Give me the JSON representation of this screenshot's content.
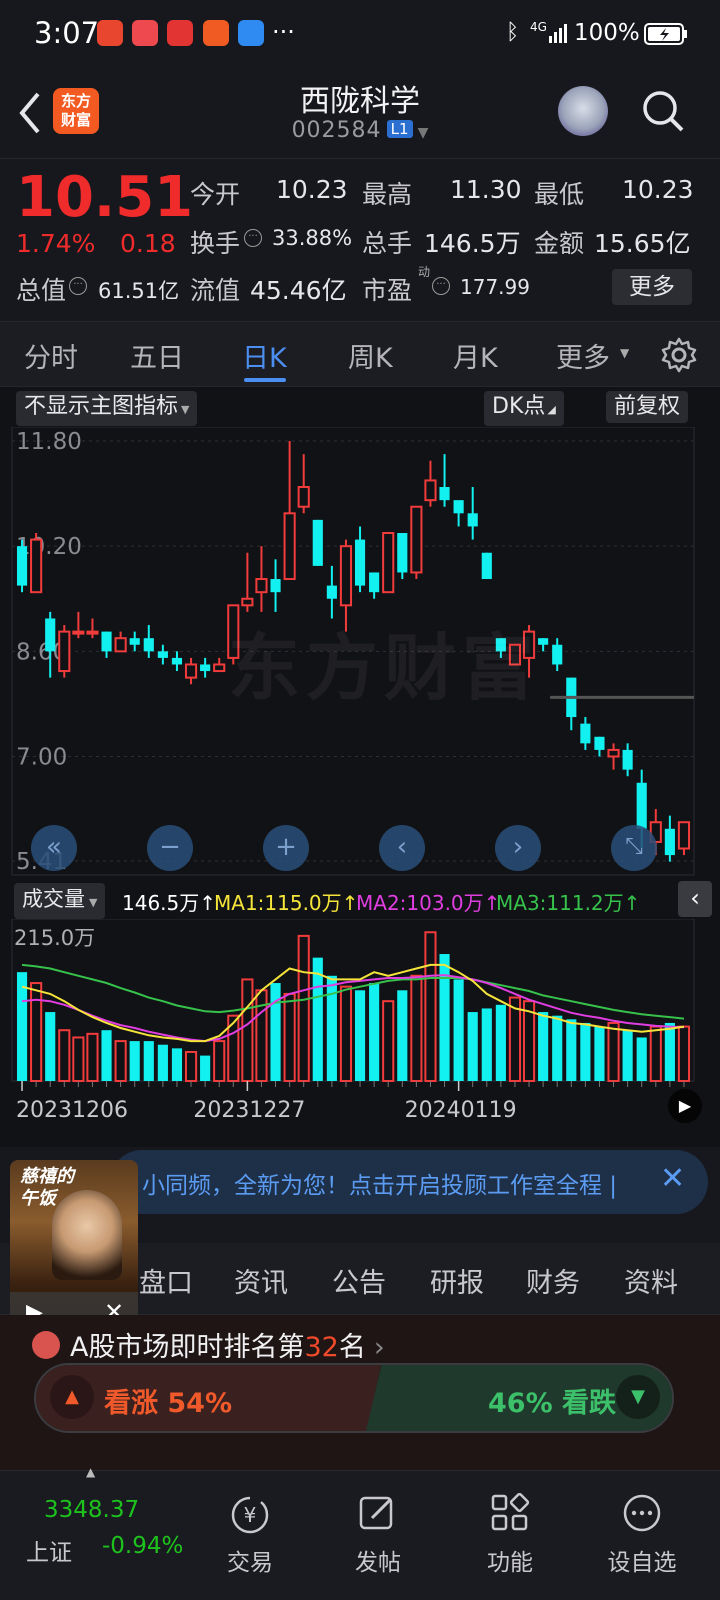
{
  "status": {
    "time": "3:07",
    "dots": "···",
    "network": "4G",
    "battery": "100%"
  },
  "header": {
    "logo_line1": "东方",
    "logo_line2": "财富",
    "title": "西陇科学",
    "code": "002584",
    "level": "L1"
  },
  "quote": {
    "price": "10.51",
    "change_pct": "1.74%",
    "change": "0.18",
    "open_label": "今开",
    "open": "10.23",
    "high_label": "最高",
    "high": "11.30",
    "low_label": "最低",
    "low": "10.23",
    "turnover_label": "换手",
    "turnover": "33.88%",
    "volume_label": "总手",
    "volume": "146.5万",
    "amount_label": "金额",
    "amount": "15.65亿",
    "mktcap_label": "总值",
    "mktcap": "61.51亿",
    "float_label": "流值",
    "float": "45.46亿",
    "pe_label": "市盈",
    "pe_super": "动",
    "pe": "177.99",
    "more_button": "更多"
  },
  "tabs": [
    "分时",
    "五日",
    "日K",
    "周K",
    "月K",
    "更多"
  ],
  "active_tab": "日K",
  "chart_toolbar": {
    "indicator": "不显示主图指标",
    "dk": "DK点",
    "adjust": "前复权"
  },
  "watermark": "东方财富",
  "chart_data": {
    "type": "candlestick",
    "yticks": [
      "11.80",
      "10.20",
      "8.60",
      "7.00",
      "5.41"
    ],
    "ylim": [
      5.41,
      11.8
    ],
    "candles": [
      [
        10.2,
        9.6,
        10.3,
        9.5
      ],
      [
        9.5,
        10.3,
        10.4,
        9.5
      ],
      [
        9.1,
        8.6,
        9.2,
        8.2
      ],
      [
        8.3,
        8.9,
        9.0,
        8.2
      ],
      [
        8.9,
        8.9,
        9.2,
        8.8
      ],
      [
        8.9,
        8.9,
        9.1,
        8.8
      ],
      [
        8.9,
        8.6,
        8.9,
        8.5
      ],
      [
        8.6,
        8.8,
        8.9,
        8.6
      ],
      [
        8.8,
        8.7,
        8.9,
        8.6
      ],
      [
        8.8,
        8.6,
        9.0,
        8.5
      ],
      [
        8.6,
        8.5,
        8.7,
        8.4
      ],
      [
        8.5,
        8.4,
        8.6,
        8.3
      ],
      [
        8.2,
        8.4,
        8.5,
        8.1
      ],
      [
        8.4,
        8.3,
        8.5,
        8.2
      ],
      [
        8.3,
        8.4,
        8.5,
        8.3
      ],
      [
        8.5,
        9.3,
        9.3,
        8.4
      ],
      [
        9.3,
        9.4,
        10.1,
        9.2
      ],
      [
        9.5,
        9.7,
        10.2,
        9.2
      ],
      [
        9.7,
        9.5,
        10.0,
        9.2
      ],
      [
        9.7,
        10.7,
        11.8,
        9.7
      ],
      [
        10.8,
        11.1,
        11.6,
        10.7
      ],
      [
        10.6,
        9.9,
        10.6,
        9.9
      ],
      [
        9.6,
        9.4,
        9.9,
        9.1
      ],
      [
        9.3,
        10.2,
        10.3,
        8.9
      ],
      [
        10.3,
        9.6,
        10.5,
        9.5
      ],
      [
        9.8,
        9.5,
        9.8,
        9.4
      ],
      [
        9.5,
        10.4,
        10.4,
        9.5
      ],
      [
        10.4,
        9.8,
        10.4,
        9.7
      ],
      [
        9.8,
        10.8,
        10.8,
        9.7
      ],
      [
        10.9,
        11.2,
        11.5,
        10.8
      ],
      [
        11.1,
        10.9,
        11.6,
        10.8
      ],
      [
        10.9,
        10.7,
        10.8,
        10.5
      ],
      [
        10.7,
        10.5,
        11.1,
        10.3
      ],
      [
        10.1,
        9.7,
        10.1,
        9.7
      ],
      [
        8.8,
        8.6,
        8.8,
        8.5
      ],
      [
        8.4,
        8.7,
        8.7,
        8.4
      ],
      [
        8.5,
        8.9,
        9.0,
        8.2
      ],
      [
        8.8,
        8.7,
        8.8,
        8.6
      ],
      [
        8.7,
        8.4,
        8.8,
        8.3
      ],
      [
        8.2,
        7.6,
        8.2,
        7.4
      ],
      [
        7.5,
        7.2,
        7.6,
        7.1
      ],
      [
        7.3,
        7.1,
        7.3,
        7.0
      ],
      [
        7.0,
        7.1,
        7.2,
        6.8
      ],
      [
        7.1,
        6.8,
        7.2,
        6.7
      ],
      [
        6.6,
        5.9,
        6.8,
        5.6
      ],
      [
        5.7,
        6.0,
        6.2,
        5.5
      ],
      [
        5.9,
        5.5,
        6.1,
        5.4
      ],
      [
        5.6,
        6.0,
        6.0,
        5.5
      ]
    ],
    "volume_label": "成交量",
    "volume_value": "146.5万↑",
    "ma1": "MA1:115.0万↑",
    "ma2": "MA2:103.0万↑",
    "ma3": "MA3:111.2万↑",
    "volume_max_label": "215.0万",
    "volumes": [
      150,
      135,
      95,
      70,
      60,
      65,
      70,
      55,
      55,
      55,
      50,
      45,
      40,
      35,
      55,
      90,
      140,
      125,
      135,
      120,
      200,
      170,
      145,
      130,
      125,
      135,
      110,
      125,
      145,
      205,
      175,
      140,
      95,
      100,
      105,
      115,
      110,
      95,
      90,
      85,
      80,
      75,
      80,
      70,
      60,
      75,
      80,
      75
    ],
    "ma1_values": [
      130,
      125,
      120,
      110,
      98,
      88,
      80,
      73,
      68,
      63,
      60,
      58,
      55,
      55,
      62,
      80,
      102,
      125,
      140,
      155,
      150,
      148,
      140,
      140,
      140,
      150,
      145,
      150,
      155,
      160,
      160,
      150,
      138,
      120,
      110,
      100,
      96,
      90,
      86,
      80,
      78,
      75,
      72,
      70,
      68,
      70,
      72,
      75
    ],
    "ma2_values": [
      110,
      112,
      110,
      105,
      98,
      90,
      83,
      77,
      73,
      68,
      64,
      60,
      57,
      55,
      58,
      66,
      78,
      95,
      110,
      120,
      125,
      130,
      132,
      136,
      138,
      140,
      142,
      142,
      143,
      145,
      146,
      143,
      140,
      135,
      128,
      120,
      112,
      106,
      100,
      94,
      90,
      87,
      83,
      80,
      78,
      76,
      75,
      74
    ],
    "ma3_values": [
      160,
      158,
      155,
      150,
      145,
      140,
      135,
      128,
      122,
      115,
      110,
      104,
      100,
      96,
      95,
      97,
      100,
      104,
      108,
      110,
      112,
      116,
      120,
      126,
      130,
      134,
      138,
      140,
      140,
      142,
      142,
      142,
      140,
      136,
      132,
      128,
      124,
      118,
      114,
      110,
      106,
      102,
      98,
      95,
      92,
      90,
      88,
      86
    ],
    "x_labels": [
      "20231206",
      "20231227",
      "20240119"
    ]
  },
  "banner": {
    "text": "小同频，全新为您！点击开启投顾工作室全程 |",
    "video_title": "慈禧的午饭"
  },
  "function_tabs": [
    "盘口",
    "资讯",
    "公告",
    "研报",
    "财务",
    "资料"
  ],
  "rank": {
    "prefix": "A股市场即时排名第",
    "number": "32",
    "suffix": "名"
  },
  "sentiment": {
    "up_label": "看涨 54%",
    "down_label": "46% 看跌",
    "up_pct": 54
  },
  "bottom": {
    "index_value": "3348.37",
    "index_name": "上证",
    "index_change": "-0.94%",
    "trade": "交易",
    "post": "发帖",
    "features": "功能",
    "watchlist": "设自选"
  }
}
